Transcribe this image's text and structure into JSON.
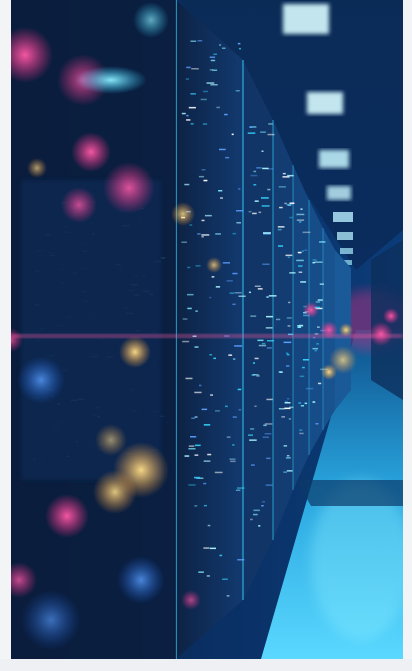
{
  "image": {
    "subject": "server-room-corridor",
    "palette": {
      "base": "#061226",
      "cyan": "#33d4ff",
      "blue": "#1b5fd6",
      "magenta": "#ff2e88",
      "orange": "#ffb347",
      "floor": "#5ad8ff"
    }
  }
}
